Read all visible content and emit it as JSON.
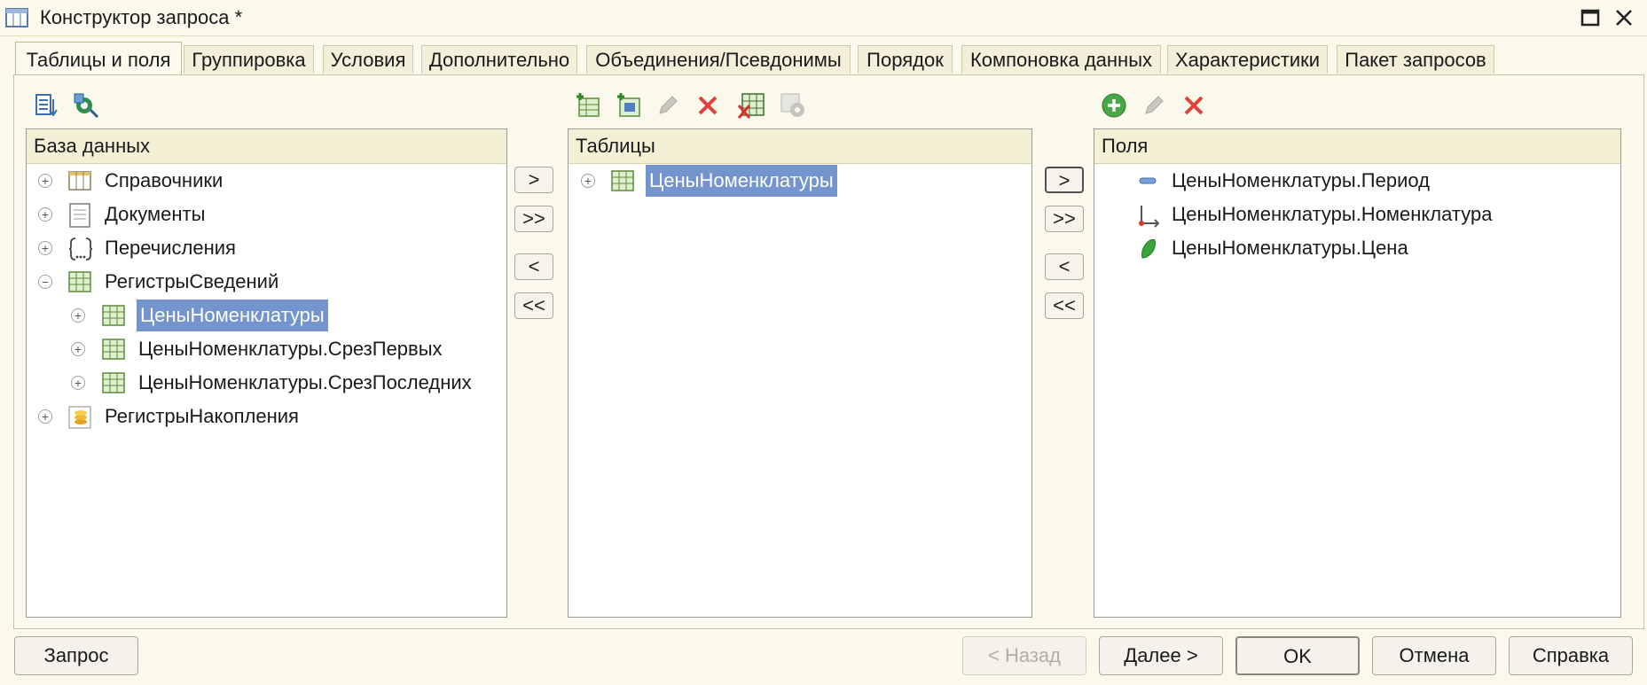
{
  "window": {
    "title": "Конструктор запроса *"
  },
  "tabs": [
    {
      "label": "Таблицы и поля"
    },
    {
      "label": "Группировка"
    },
    {
      "label": "Условия"
    },
    {
      "label": "Дополнительно"
    },
    {
      "label": "Объединения/Псевдонимы"
    },
    {
      "label": "Порядок"
    },
    {
      "label": "Компоновка данных"
    },
    {
      "label": "Характеристики"
    },
    {
      "label": "Пакет запросов"
    }
  ],
  "database": {
    "header": "База данных",
    "items": [
      {
        "label": "Справочники",
        "icon": "catalog-icon"
      },
      {
        "label": "Документы",
        "icon": "document-icon"
      },
      {
        "label": "Перечисления",
        "icon": "enum-icon"
      },
      {
        "label": "РегистрыСведений",
        "icon": "register-icon"
      },
      {
        "label": "ЦеныНоменклатуры",
        "icon": "register-icon"
      },
      {
        "label": "ЦеныНоменклатуры.СрезПервых",
        "icon": "register-icon"
      },
      {
        "label": "ЦеныНоменклатуры.СрезПоследних",
        "icon": "register-icon"
      },
      {
        "label": "РегистрыНакопления",
        "icon": "accumulation-icon"
      }
    ]
  },
  "tables": {
    "header": "Таблицы",
    "items": [
      {
        "label": "ЦеныНоменклатуры"
      }
    ]
  },
  "fields": {
    "header": "Поля",
    "items": [
      {
        "label": "ЦеныНоменклатуры.Период"
      },
      {
        "label": "ЦеныНоменклатуры.Номенклатура"
      },
      {
        "label": "ЦеныНоменклатуры.Цена"
      }
    ]
  },
  "move_buttons": {
    "one": ">",
    "all": ">>",
    "back_one": "<",
    "back_all": "<<"
  },
  "footer": {
    "query": "Запрос",
    "back": "< Назад",
    "next": "Далее >",
    "ok": "OK",
    "cancel": "Отмена",
    "help": "Справка"
  },
  "colors": {
    "selection": "#7394cc",
    "background": "#fbf9ec",
    "header": "#f4f0d6"
  }
}
